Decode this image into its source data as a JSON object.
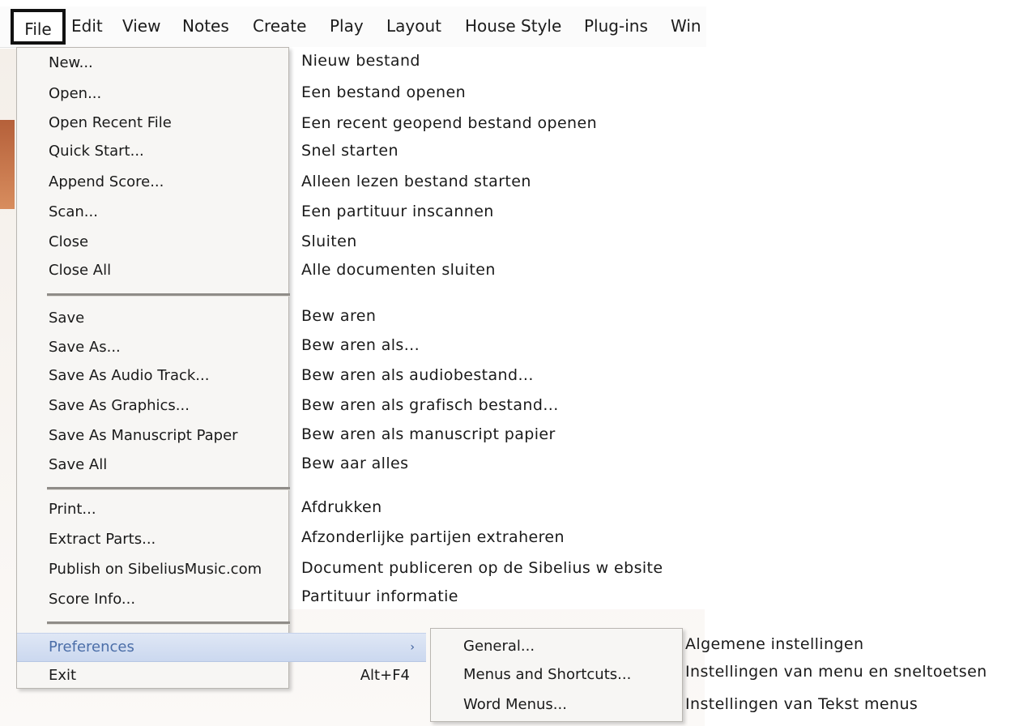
{
  "menubar": {
    "items": [
      "File",
      "Edit",
      "View",
      "Notes",
      "Create",
      "Play",
      "Layout",
      "House Style",
      "Plug-ins",
      "Win"
    ]
  },
  "file_menu": {
    "groups": [
      [
        {
          "label": "New...",
          "desc": "Nieuw bestand"
        },
        {
          "label": "Open...",
          "desc": "Een bestand openen"
        },
        {
          "label": "Open Recent File",
          "desc": "Een recent geopend bestand openen"
        },
        {
          "label": "Quick Start...",
          "desc": "Snel starten"
        },
        {
          "label": "Append Score...",
          "desc": "Alleen lezen bestand starten"
        },
        {
          "label": "Scan...",
          "desc": "Een partituur inscannen"
        },
        {
          "label": "Close",
          "desc": "Sluiten"
        },
        {
          "label": "Close All",
          "desc": "Alle documenten sluiten"
        }
      ],
      [
        {
          "label": "Save",
          "desc": "Bew aren"
        },
        {
          "label": "Save As...",
          "desc": "Bew aren als..."
        },
        {
          "label": "Save As Audio Track...",
          "desc": "Bew aren als audiobestand..."
        },
        {
          "label": "Save As Graphics...",
          "desc": "Bew aren als grafisch bestand..."
        },
        {
          "label": "Save As Manuscript Paper",
          "desc": "Bew aren als manuscript papier"
        },
        {
          "label": "Save All",
          "desc": "Bew aar alles"
        }
      ],
      [
        {
          "label": "Print...",
          "desc": "Afdrukken"
        },
        {
          "label": "Extract Parts...",
          "desc": "Afzonderlijke partijen extraheren"
        },
        {
          "label": "Publish on SibeliusMusic.com",
          "desc": "Document publiceren op de Sibelius w ebsite"
        },
        {
          "label": "Score Info...",
          "desc": "Partituur informatie"
        }
      ]
    ],
    "preferences": {
      "label": "Preferences",
      "arrow": "›"
    },
    "exit": {
      "label": "Exit",
      "shortcut": "Alt+F4"
    }
  },
  "preferences_submenu": [
    {
      "label": "General...",
      "desc": "Algemene instellingen"
    },
    {
      "label": "Menus and Shortcuts...",
      "desc": "Instellingen van menu en sneltoetsen"
    },
    {
      "label": "Word Menus...",
      "desc": "Instellingen van Tekst menus"
    }
  ]
}
